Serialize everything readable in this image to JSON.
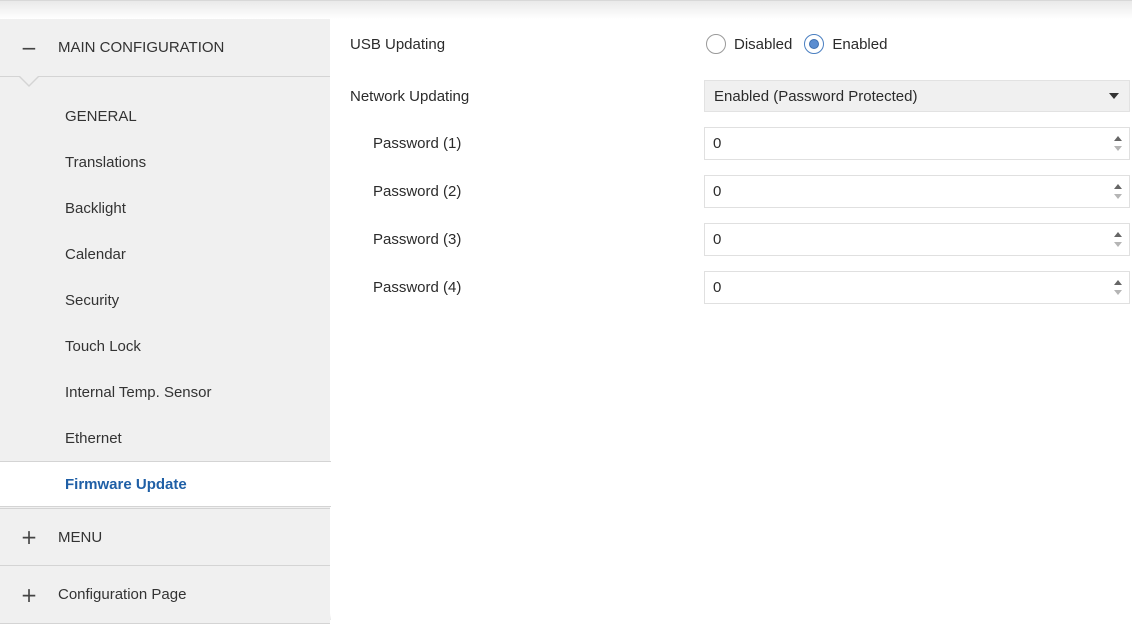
{
  "sidebar": {
    "main_group": {
      "toggle": "−",
      "label": "MAIN CONFIGURATION"
    },
    "items": [
      {
        "label": "GENERAL"
      },
      {
        "label": "Translations"
      },
      {
        "label": "Backlight"
      },
      {
        "label": "Calendar"
      },
      {
        "label": "Security"
      },
      {
        "label": "Touch Lock"
      },
      {
        "label": "Internal Temp. Sensor"
      },
      {
        "label": "Ethernet"
      },
      {
        "label": "Firmware Update",
        "active": true
      }
    ],
    "menu_group": {
      "toggle": "+",
      "label": "MENU"
    },
    "config_group": {
      "toggle": "+",
      "label": "Configuration Page"
    }
  },
  "main": {
    "usb_updating": {
      "label": "USB Updating",
      "options": [
        "Disabled",
        "Enabled"
      ],
      "selected": "Enabled"
    },
    "network_updating": {
      "label": "Network Updating",
      "value": "Enabled (Password Protected)"
    },
    "passwords": [
      {
        "label": "Password (1)",
        "value": "0"
      },
      {
        "label": "Password (2)",
        "value": "0"
      },
      {
        "label": "Password (3)",
        "value": "0"
      },
      {
        "label": "Password (4)",
        "value": "0"
      }
    ]
  },
  "colors": {
    "sidebar_bg": "#f0f0f0",
    "active_text": "#1f5fa6",
    "radio_accent": "#5b8dd0"
  }
}
